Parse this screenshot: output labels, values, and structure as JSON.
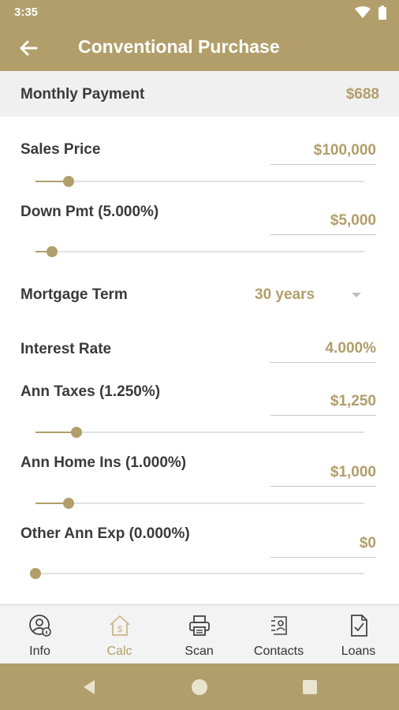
{
  "status_bar": {
    "time": "3:35",
    "wifi_icon": "wifi-icon",
    "battery_icon": "battery-icon"
  },
  "app_bar": {
    "title": "Conventional Purchase",
    "back_icon": "arrow-left-icon"
  },
  "summary": {
    "label": "Monthly Payment",
    "value": "$688"
  },
  "fields": {
    "sales_price": {
      "label": "Sales Price",
      "value": "$100,000",
      "slider_fraction": 0.1
    },
    "down_payment": {
      "label": "Down Pmt (5.000%)",
      "value": "$5,000",
      "slider_fraction": 0.05
    },
    "mortgage_term": {
      "label": "Mortgage Term",
      "value": "30 years",
      "dropdown_icon": "caret-down-icon"
    },
    "interest_rate": {
      "label": "Interest Rate",
      "value": "4.000%"
    },
    "annual_taxes": {
      "label": "Ann Taxes (1.250%)",
      "value": "$1,250",
      "slider_fraction": 0.125
    },
    "annual_home_insurance": {
      "label": "Ann Home Ins (1.000%)",
      "value": "$1,000",
      "slider_fraction": 0.1
    },
    "other_annual_expenses": {
      "label": "Other Ann Exp (0.000%)",
      "value": "$0",
      "slider_fraction": 0.0
    }
  },
  "bottom_nav": {
    "items": [
      {
        "label": "Info",
        "icon": "user-info-icon",
        "active": false
      },
      {
        "label": "Calc",
        "icon": "house-dollar-icon",
        "active": true
      },
      {
        "label": "Scan",
        "icon": "printer-icon",
        "active": false
      },
      {
        "label": "Contacts",
        "icon": "contacts-icon",
        "active": false
      },
      {
        "label": "Loans",
        "icon": "document-check-icon",
        "active": false
      }
    ]
  },
  "colors": {
    "accent": "#b19e6a",
    "text": "#3a3a3a",
    "summary_bg": "#f0f0f0",
    "nav_bg": "#f3f3f3"
  }
}
